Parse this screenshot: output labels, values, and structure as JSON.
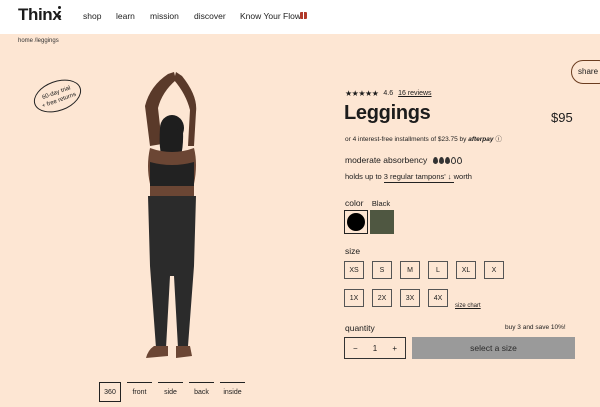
{
  "nav": {
    "logo": "Thinx",
    "links": [
      "shop",
      "learn",
      "mission",
      "discover",
      "Know Your Flow"
    ]
  },
  "breadcrumb": "home /leggings",
  "badge": {
    "line1": "60-day trial",
    "line2": "+ free returns"
  },
  "share_label": "share",
  "view_tabs": [
    "360",
    "front",
    "side",
    "back",
    "inside"
  ],
  "product": {
    "rating": "4.6",
    "reviews": "16 reviews",
    "title": "Leggings",
    "price": "$95",
    "installments_text": "or 4 interest-free installments of $23.75 by",
    "installments_brand": "afterpay",
    "absorbency_label": "moderate absorbency",
    "absorbency_level": 3,
    "absorbency_max": 5,
    "holds_prefix": "holds up to",
    "holds_value": "3 regular tampons'",
    "holds_suffix": "worth",
    "color_label": "color",
    "color_value": "Black",
    "swatches": [
      "#000000",
      "#4f5741"
    ],
    "size_label": "size",
    "sizes": [
      "XS",
      "S",
      "M",
      "L",
      "XL",
      "X",
      "1X",
      "2X",
      "3X",
      "4X"
    ],
    "size_chart": "size chart",
    "quantity_label": "quantity",
    "promo": "buy 3 and save 10%!",
    "quantity": "1",
    "cta": "select a size"
  }
}
